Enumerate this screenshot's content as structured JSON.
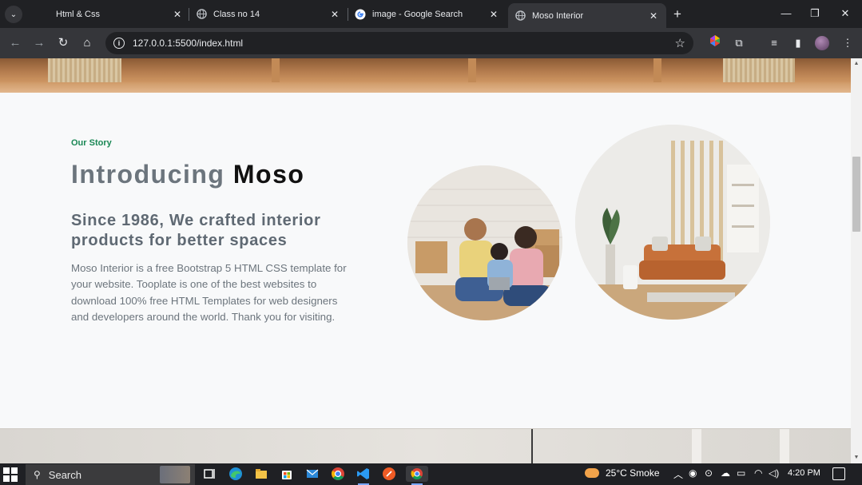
{
  "browser": {
    "tabs": [
      {
        "title": "Html & Css",
        "favicon": "blank-icon",
        "active": false
      },
      {
        "title": "Class no 14",
        "favicon": "globe-icon",
        "active": false
      },
      {
        "title": "image - Google Search",
        "favicon": "google-icon",
        "active": false
      },
      {
        "title": "Moso Interior",
        "favicon": "globe-icon",
        "active": true
      }
    ],
    "url": "127.0.0.1:5500/index.html"
  },
  "page": {
    "eyebrow": "Our Story",
    "heading_muted": "Introducing",
    "heading_dark": "Moso",
    "subheading": "Since 1986, We crafted interior products for better spaces",
    "paragraph": "Moso Interior is a free Bootstrap 5 HTML CSS template for your website. Tooplate is one of the best websites to download 100% free HTML Templates for web designers and developers around the world. Thank you for visiting.",
    "accent_color": "#198754"
  },
  "taskbar": {
    "search_label": "Search",
    "weather": "25°C Smoke",
    "time": "4:20 PM"
  }
}
